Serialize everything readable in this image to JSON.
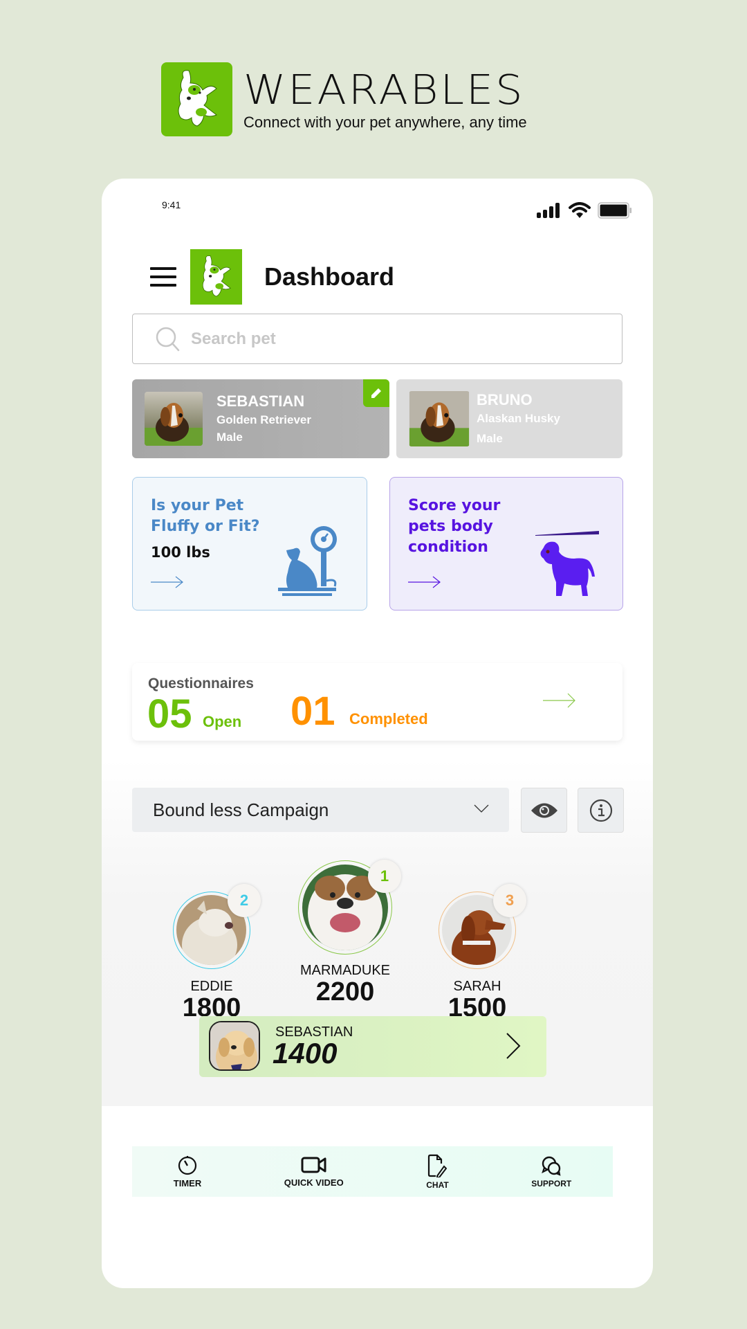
{
  "brand": {
    "title": "WEARABLES",
    "tagline": "Connect with your pet anywhere, any time",
    "color": "#6cc00a"
  },
  "status_bar": {
    "time": "9:41",
    "icons": [
      "signal-icon",
      "wifi-icon",
      "battery-icon"
    ]
  },
  "header": {
    "menu_icon": "hamburger-icon",
    "title": "Dashboard"
  },
  "search": {
    "placeholder": "Search pet",
    "value": ""
  },
  "pets": [
    {
      "name": "SEBASTIAN",
      "breed": "Golden Retriever",
      "sex": "Male",
      "selected": true
    },
    {
      "name": "BRUNO",
      "breed": "Alaskan Husky",
      "sex": "Male",
      "selected": false
    }
  ],
  "promos": [
    {
      "title_line1": "Is your Pet",
      "title_line2": "Fluffy or Fit?",
      "value": "100 lbs",
      "color": "#4a88c7"
    },
    {
      "title_line1": "Score your",
      "title_line2": "pets body",
      "title_line3": "condition",
      "color": "#5714e0"
    }
  ],
  "questionnaires": {
    "title": "Questionnaires",
    "open_count": "05",
    "open_label": "Open",
    "completed_count": "01",
    "completed_label": "Completed",
    "open_color": "#6cc00a",
    "completed_color": "#ff9100"
  },
  "campaign": {
    "selected": "Bound less Campaign"
  },
  "leaderboard": [
    {
      "rank": "2",
      "name": "EDDIE",
      "score": "1800",
      "color": "#3fcbe6"
    },
    {
      "rank": "1",
      "name": "MARMADUKE",
      "score": "2200",
      "color": "#6cc00a"
    },
    {
      "rank": "3",
      "name": "SARAH",
      "score": "1500",
      "color": "#f0a050"
    }
  ],
  "my_rank": {
    "name": "SEBASTIAN",
    "score": "1400"
  },
  "bottom_nav": [
    {
      "label": "TIMER",
      "icon": "timer-icon"
    },
    {
      "label": "QUICK VIDEO",
      "icon": "video-camera-icon"
    },
    {
      "label": "CHAT",
      "icon": "chat-document-icon"
    },
    {
      "label": "SUPPORT",
      "icon": "support-bubbles-icon"
    }
  ]
}
